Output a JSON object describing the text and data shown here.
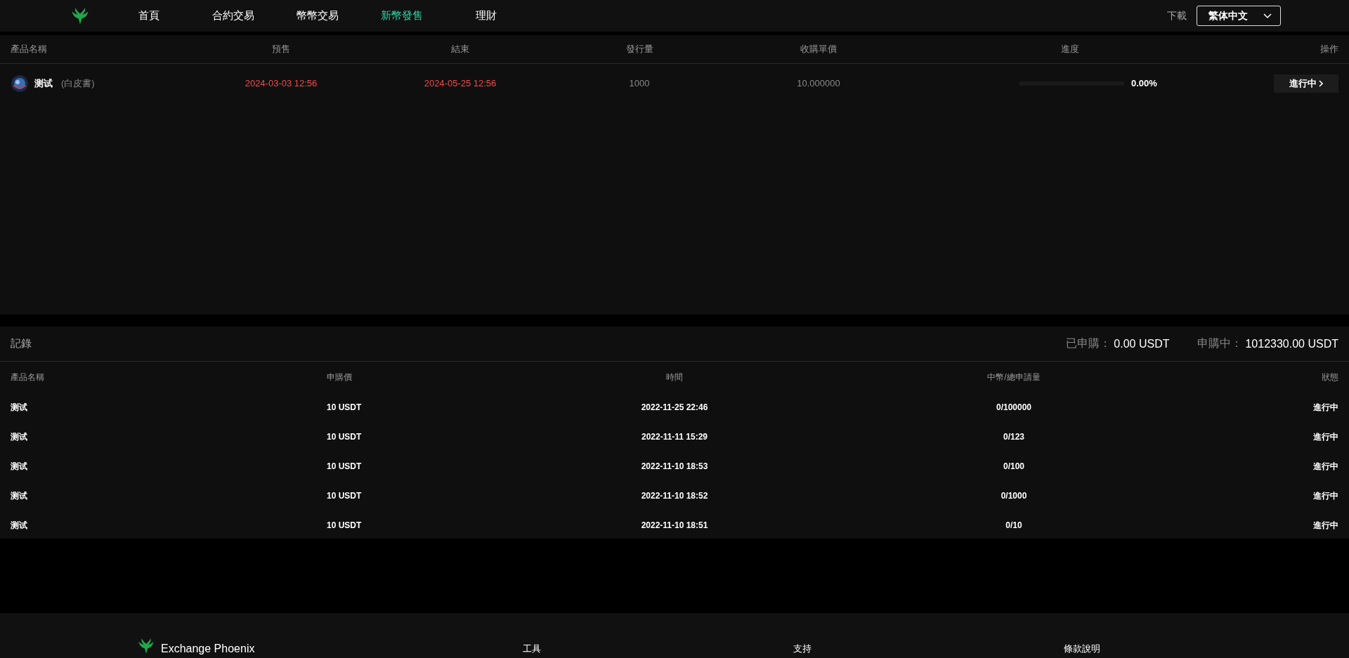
{
  "header": {
    "nav": [
      {
        "label": "首頁",
        "selected": false
      },
      {
        "label": "合約交易",
        "selected": false
      },
      {
        "label": "幣幣交易",
        "selected": false
      },
      {
        "label": "新幣發售",
        "selected": true
      },
      {
        "label": "理財",
        "selected": false
      }
    ],
    "download": "下載",
    "language": "繁体中文"
  },
  "products": {
    "columns": [
      "產品名稱",
      "預售",
      "結束",
      "發行量",
      "收購單價",
      "進度",
      "操作"
    ],
    "rows": [
      {
        "name": "测试",
        "whitepaper": "(白皮書)",
        "presale": "2024-03-03 12:56",
        "end": "2024-05-25 12:56",
        "issued": "1000",
        "price": "10.000000",
        "progress": {
          "level": 0,
          "reading": "0.00%"
        },
        "action": "進行中"
      }
    ]
  },
  "records": {
    "title": "記錄",
    "summary": [
      {
        "label": "已申購：",
        "value": "0.00 USDT"
      },
      {
        "label": "申購中：",
        "value": "1012330.00 USDT"
      }
    ],
    "columns": [
      "產品名稱",
      "申購價",
      "時間",
      "中幣/總申請量",
      "狀態"
    ],
    "rows": [
      {
        "name": "测试",
        "price": "10 USDT",
        "time": "2022-11-25 22:46",
        "amount": "0/100000",
        "status": "進行中"
      },
      {
        "name": "测试",
        "price": "10 USDT",
        "time": "2022-11-11 15:29",
        "amount": "0/123",
        "status": "進行中"
      },
      {
        "name": "测试",
        "price": "10 USDT",
        "time": "2022-11-10 18:53",
        "amount": "0/100",
        "status": "進行中"
      },
      {
        "name": "测试",
        "price": "10 USDT",
        "time": "2022-11-10 18:52",
        "amount": "0/1000",
        "status": "進行中"
      },
      {
        "name": "测试",
        "price": "10 USDT",
        "time": "2022-11-10 18:51",
        "amount": "0/10",
        "status": "進行中"
      }
    ]
  },
  "footer": {
    "brand": "Exchange Phoenix",
    "links": [
      "工具",
      "支持",
      "條款說明"
    ]
  }
}
